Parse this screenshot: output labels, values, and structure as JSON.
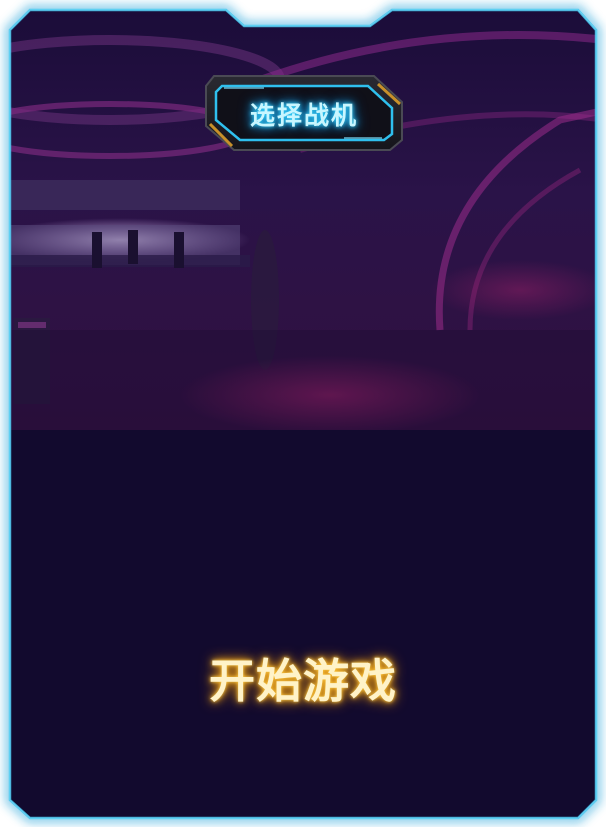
{
  "screen": {
    "title": "选择战机",
    "start_button_label": "开始游戏"
  },
  "colors": {
    "frame_glow": "#2fb8e8",
    "panel_background": "#120a2e",
    "scene_magenta": "#7a1f7e",
    "title_glow": "#38d9ff",
    "start_glow": "#ffb21e"
  },
  "icons": {
    "frame": "hud-frame-icon",
    "title_badge": "hud-badge-icon"
  }
}
